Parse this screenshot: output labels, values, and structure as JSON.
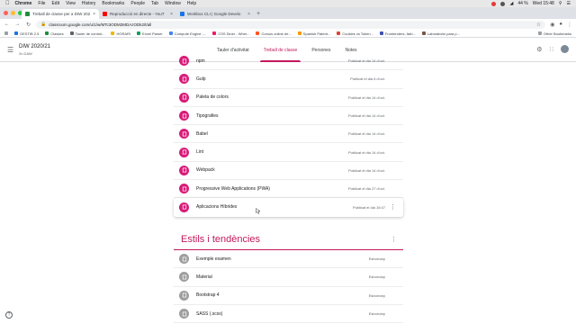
{
  "menubar": {
    "app": "Chrome",
    "items": [
      "File",
      "Edit",
      "View",
      "History",
      "Bookmarks",
      "People",
      "Tab",
      "Window",
      "Help"
    ],
    "battery": "44 %",
    "clock": "Wed 15:48"
  },
  "tabs": [
    {
      "title": "Treball de classe per a DIW 2020",
      "active": true,
      "color": "#1e8e3e"
    },
    {
      "title": "Reproducció en directe - YouT",
      "active": false,
      "color": "#ff0000"
    },
    {
      "title": "Workbox CLI | Google Develo",
      "active": false,
      "color": "#1a73e8"
    }
  ],
  "address": {
    "url": "classroom.google.com/u/1/w/MTc3ODM2MDAzODk2/t/all"
  },
  "bookmarks": {
    "items": [
      {
        "label": "GESTIB 2.5",
        "color": "#1a73e8"
      },
      {
        "label": "Classes",
        "color": "#1e8e3e"
      },
      {
        "label": "Tauler de control...",
        "color": "#5f6368"
      },
      {
        "label": "HORARI",
        "color": "#f4b400"
      },
      {
        "label": "Excel Parser",
        "color": "#0f9d58"
      },
      {
        "label": "Compute Engine -...",
        "color": "#4285f4"
      },
      {
        "label": "CSS Diner - Wher...",
        "color": "#e91e63"
      },
      {
        "label": "Cursos online de...",
        "color": "#ff5722"
      },
      {
        "label": "Spanish Patent...",
        "color": "#ff9800"
      },
      {
        "label": "Cookies vs Token...",
        "color": "#db4437"
      },
      {
        "label": "Frontenders, farb...",
        "color": "#3f51b5"
      },
      {
        "label": "Laboratorio para p...",
        "color": "#795548"
      }
    ],
    "other": "Other Bookmarks"
  },
  "classroom": {
    "title": "DIW 2020/21",
    "subtitle": "2n DAW",
    "tabs": [
      "Tauler d'activitat",
      "Treball de classe",
      "Persones",
      "Notes"
    ],
    "active_tab": 1
  },
  "materials": [
    {
      "name": "npm",
      "date": "Publicat el dia 14 d'oct."
    },
    {
      "name": "Gulp",
      "date": "Publicat el dia 6 d'oct."
    },
    {
      "name": "Paleta de colors",
      "date": "Publicat el dia 14 d'oct."
    },
    {
      "name": "Tipografies",
      "date": "Publicat el dia 14 d'oct."
    },
    {
      "name": "Babel",
      "date": "Publicat el dia 14 d'oct."
    },
    {
      "name": "Lint",
      "date": "Publicat el dia 14 d'oct."
    },
    {
      "name": "Webpack",
      "date": "Publicat el dia 14 d'oct."
    },
    {
      "name": "Progressive Web Applications (PWA)",
      "date": "Publicat el dia 27 d'oct."
    },
    {
      "name": "Aplicacions Híbrides",
      "date": "Publicat el dia 15:47"
    }
  ],
  "section": {
    "title": "Estils i tendències",
    "items": [
      {
        "name": "Exemple examen",
        "status": "Esborrany"
      },
      {
        "name": "Material",
        "status": "Esborrany"
      },
      {
        "name": "Bootstrap 4",
        "status": "Esborrany"
      },
      {
        "name": "SASS (.scss)",
        "status": "Esborrany"
      }
    ]
  },
  "colors": {
    "accent": "#c2185b",
    "material_icon": "#d81b78",
    "draft_icon": "#9e9e9e"
  }
}
